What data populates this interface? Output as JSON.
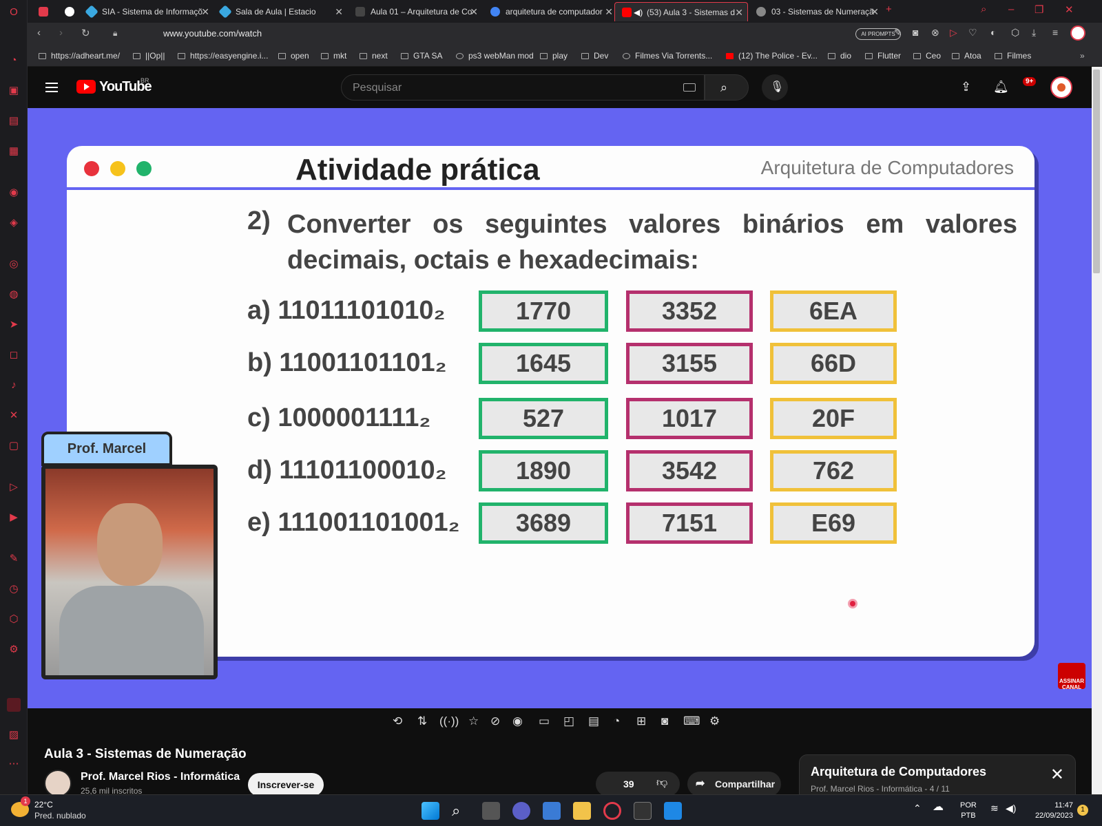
{
  "tabs": [
    {
      "label": "SIA - Sistema de Informaçõ",
      "color": "#3aa8e0"
    },
    {
      "label": "Sala de Aula | Estacio",
      "color": "#3aa8e0"
    },
    {
      "label": "Aula 01 – Arquitetura de Co",
      "color": "#444"
    },
    {
      "label": "arquitetura de computador",
      "color": "#4285f4"
    },
    {
      "label": "(53) Aula 3 - Sistemas d",
      "color": "#ff0000"
    },
    {
      "label": "03 - Sistemas de Numeraçã",
      "color": "#888"
    }
  ],
  "address": {
    "url": "www.youtube.com/watch",
    "ai_prompts": "AI PROMPTS"
  },
  "bookmarks": [
    "https://adheart.me/",
    "||Op||",
    "https://easyengine.i...",
    "open",
    "mkt",
    "next",
    "GTA SA",
    "ps3 webMan mod",
    "play",
    "Dev",
    "Filmes Via Torrents...",
    "(12) The Police - Ev...",
    "dio",
    "Flutter",
    "Ceo",
    "Atoa",
    "Filmes"
  ],
  "youtube": {
    "logo_text": "YouTube",
    "region": "BR",
    "search_placeholder": "Pesquisar",
    "notifications": "9+"
  },
  "slide": {
    "title": "Atividade prática",
    "subtitle": "Arquitetura de Computadores",
    "question_num": "2)",
    "question": "Converter os seguintes valores binários em valores decimais, octais e hexadecimais:",
    "rows": [
      {
        "label": "a) 11011101010₂",
        "dec": "1770",
        "oct": "3352",
        "hex": "6EA"
      },
      {
        "label": "b) 11001101101₂",
        "dec": "1645",
        "oct": "3155",
        "hex": "66D"
      },
      {
        "label": "c) 1000001111₂",
        "dec": "527",
        "oct": "1017",
        "hex": "20F"
      },
      {
        "label": "d) 11101100010₂",
        "dec": "1890",
        "oct": "3542",
        "hex": "762"
      },
      {
        "label": "e) 111001101001₂",
        "dec": "3689",
        "oct": "7151",
        "hex": "E69"
      }
    ],
    "presenter": "Prof. Marcel",
    "subscribe_badge": "ASSINAR CANAL"
  },
  "video": {
    "title": "Aula 3 - Sistemas de Numeração",
    "channel": "Prof. Marcel Rios - Informática",
    "subscribers": "25,6 mil inscritos",
    "subscribe": "Inscrever-se",
    "likes": "39",
    "share": "Compartilhar"
  },
  "playlist": {
    "title": "Arquitetura de Computadores",
    "subtitle": "Prof. Marcel Rios - Informática - 4 / 11"
  },
  "taskbar": {
    "temp": "22°C",
    "weather": "Pred. nublado",
    "lang1": "POR",
    "lang2": "PTB",
    "time": "11:47",
    "date": "22/09/2023",
    "weather_badge": "1",
    "notif": "1"
  },
  "colors": {
    "accent": "#e23a4b",
    "slide_bg": "#6464f2",
    "decimal": "#21b36b",
    "octal": "#b5306d",
    "hex": "#f0c13a"
  }
}
